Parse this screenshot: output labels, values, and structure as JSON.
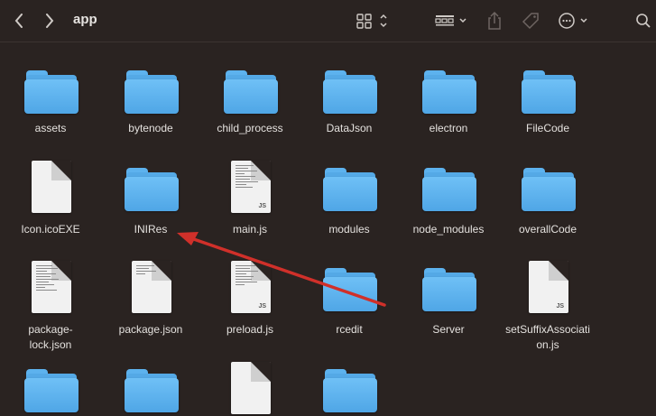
{
  "toolbar": {
    "title": "app",
    "icons": [
      "chevron-left-icon",
      "chevron-right-icon",
      "grid-view-icon",
      "group-icon",
      "share-icon",
      "tag-icon",
      "more-icon",
      "search-icon"
    ]
  },
  "files": [
    {
      "name": "assets",
      "kind": "folder"
    },
    {
      "name": "bytenode",
      "kind": "folder"
    },
    {
      "name": "child_process",
      "kind": "folder"
    },
    {
      "name": "DataJson",
      "kind": "folder"
    },
    {
      "name": "electron",
      "kind": "folder"
    },
    {
      "name": "FileCode",
      "kind": "folder"
    },
    {
      "name": "Icon.icoEXE",
      "kind": "doc"
    },
    {
      "name": "INIRes",
      "kind": "folder"
    },
    {
      "name": "main.js",
      "kind": "js"
    },
    {
      "name": "modules",
      "kind": "folder"
    },
    {
      "name": "node_modules",
      "kind": "folder"
    },
    {
      "name": "overallCode",
      "kind": "folder"
    },
    {
      "name": "package-lock.json",
      "kind": "doctext"
    },
    {
      "name": "package.json",
      "kind": "doctext"
    },
    {
      "name": "preload.js",
      "kind": "js"
    },
    {
      "name": "rcedit",
      "kind": "folder"
    },
    {
      "name": "Server",
      "kind": "folder"
    },
    {
      "name": "setSuffixAssociation.js",
      "kind": "js"
    },
    {
      "name": "",
      "kind": "folder"
    },
    {
      "name": "",
      "kind": "folder"
    },
    {
      "name": "",
      "kind": "doc"
    },
    {
      "name": "",
      "kind": "folder"
    }
  ],
  "display_labels": {
    "package_lock_line1": "package-",
    "package_lock_line2": "lock.json",
    "set_suffix_line1": "setSuffixAssociati",
    "set_suffix_line2": "on.js",
    "js_tag": "JS"
  },
  "colors": {
    "background": "#2a2321",
    "folder": "#5db2ee",
    "arrow": "#d0302a"
  }
}
